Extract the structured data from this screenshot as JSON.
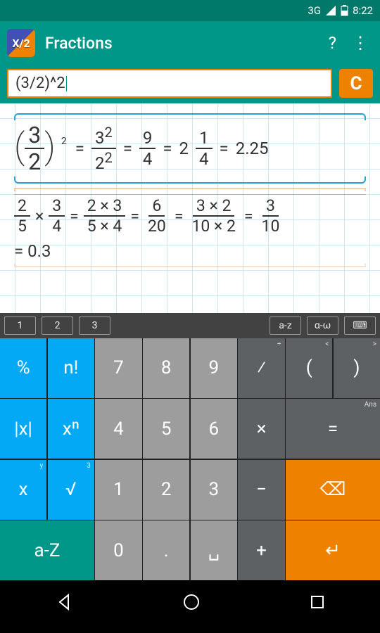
{
  "status": {
    "cell": "3G",
    "time": "8:22"
  },
  "appbar": {
    "title": "Fractions"
  },
  "input": {
    "expression": "(3/2)^2",
    "clear": "C"
  },
  "results": {
    "r1": {
      "left_num": "3",
      "left_den": "2",
      "left_exp": "2",
      "s1_num": "3",
      "s1_num_exp": "2",
      "s1_den": "2",
      "s1_den_exp": "2",
      "s2_num": "9",
      "s2_den": "4",
      "mixed_whole": "2",
      "mixed_num": "1",
      "mixed_den": "4",
      "decimal": "2.25"
    },
    "r2": {
      "a_num": "2",
      "a_den": "5",
      "b_num": "3",
      "b_den": "4",
      "s1_num": "2 × 3",
      "s1_den": "5 × 4",
      "s2_num": "6",
      "s2_den": "20",
      "s3_num": "3 × 2",
      "s3_den": "10 × 2",
      "s4_num": "3",
      "s4_den": "10",
      "decimal": "= 0.3"
    }
  },
  "mode": {
    "tabs": [
      "1",
      "2",
      "3"
    ],
    "right": [
      "a-z",
      "α-ω",
      "⌨"
    ]
  },
  "keys": {
    "pct": "%",
    "fact": "n!",
    "abs": "|x|",
    "pow": "xⁿ",
    "xy": "x",
    "xy_sup": "y",
    "sqrt": "√",
    "sqrt_sup": "3",
    "az": "a-Z",
    "n7": "7",
    "n8": "8",
    "n9": "9",
    "n4": "4",
    "n5": "5",
    "n6": "6",
    "n1": "1",
    "n2": "2",
    "n3": "3",
    "n0": "0",
    "dot": ".",
    "space": "␣",
    "div": "⁄",
    "div_sup": "÷",
    "mul": "×",
    "minus": "−",
    "plus": "+",
    "lp": "(",
    "lp_sup": "<",
    "rp": ")",
    "rp_sup": ">",
    "eq": "=",
    "eq_sup": "Ans",
    "del": "⌫",
    "enter": "↵"
  }
}
